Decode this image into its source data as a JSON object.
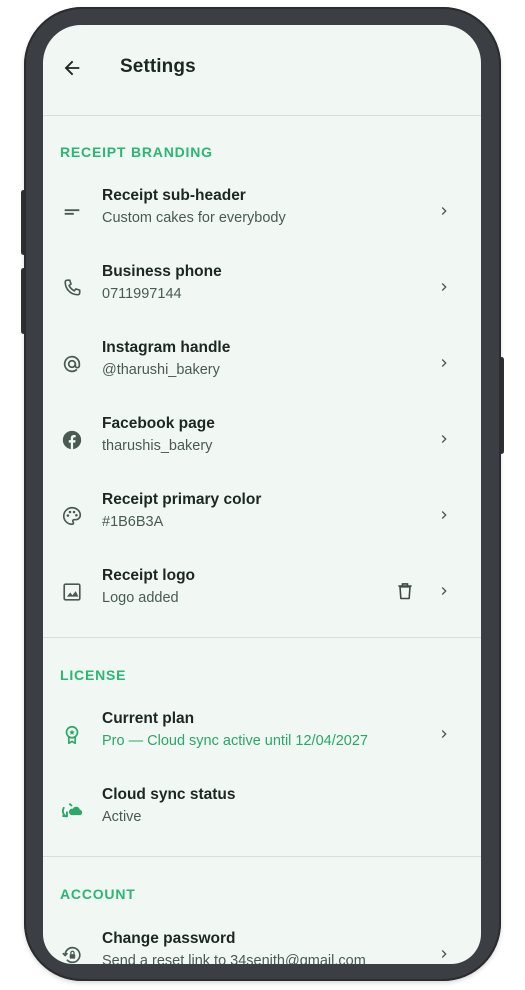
{
  "header": {
    "title": "Settings"
  },
  "sections": {
    "branding": {
      "title": "RECEIPT BRANDING",
      "items": [
        {
          "label": "Receipt sub-header",
          "value": "Custom cakes for everybody",
          "icon": "short-text-icon"
        },
        {
          "label": "Business phone",
          "value": "0711997144",
          "icon": "phone-icon"
        },
        {
          "label": "Instagram handle",
          "value": "@tharushi_bakery",
          "icon": "at-sign-icon"
        },
        {
          "label": "Facebook page",
          "value": "tharushis_bakery",
          "icon": "facebook-icon"
        },
        {
          "label": "Receipt primary color",
          "value": "#1B6B3A",
          "icon": "palette-icon"
        },
        {
          "label": "Receipt logo",
          "value": "Logo added",
          "icon": "image-icon"
        }
      ]
    },
    "license": {
      "title": "LICENSE",
      "items": [
        {
          "label": "Current plan",
          "value": "Pro — Cloud sync active until 12/04/2027",
          "icon": "award-icon"
        },
        {
          "label": "Cloud sync status",
          "value": "Active",
          "icon": "cloud-sync-icon"
        }
      ]
    },
    "account": {
      "title": "ACCOUNT",
      "items": [
        {
          "label": "Change password",
          "value": "Send a reset link to 34senith@gmail.com",
          "icon": "lock-reset-icon"
        }
      ]
    }
  },
  "colors": {
    "accent": "#2bb673",
    "background": "#f1f8f3",
    "text": "#1d2722",
    "muted": "#4a5a52",
    "frame": "#3b3e42"
  }
}
